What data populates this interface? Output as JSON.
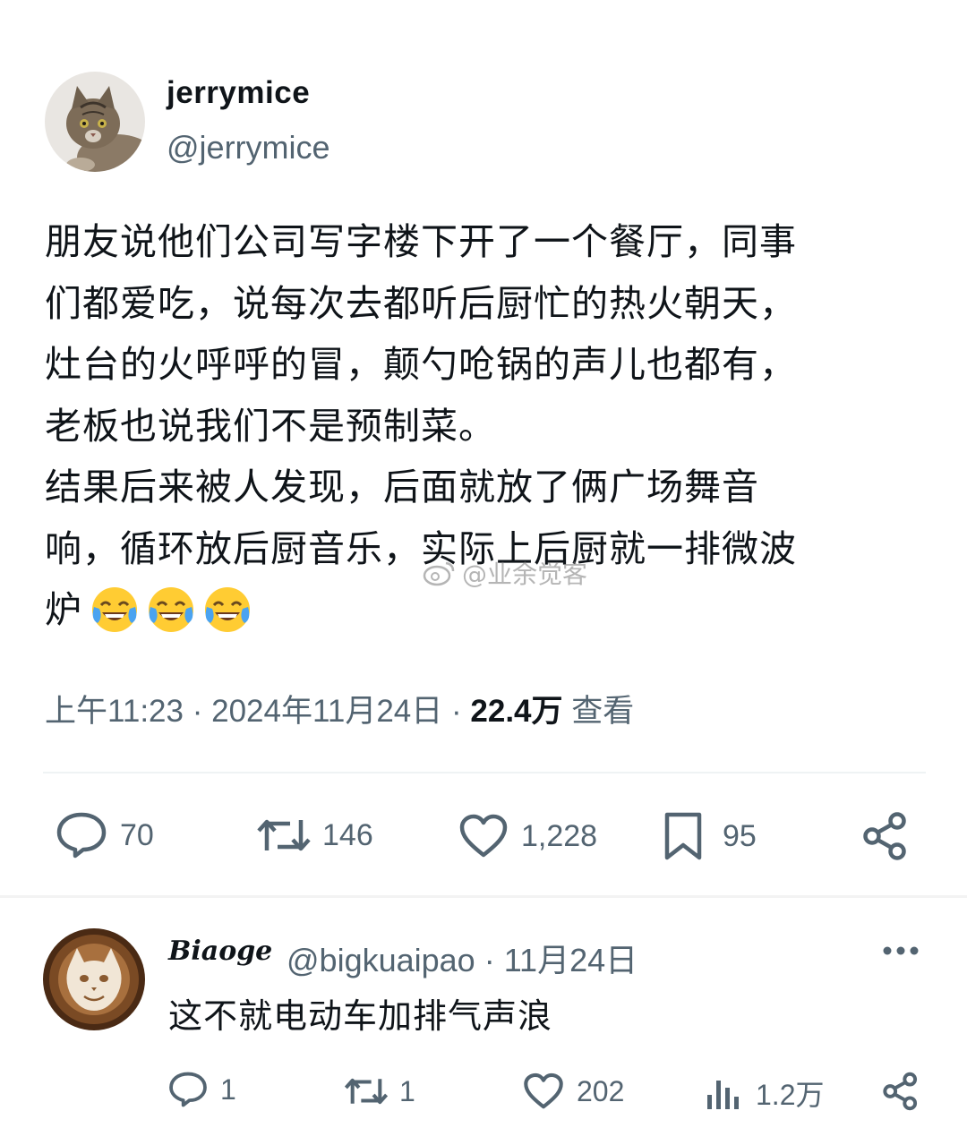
{
  "post": {
    "author_name": "jerrymice",
    "author_handle": "@jerrymice",
    "text": "朋友说他们公司写字楼下开了一个餐厅，同事\n们都爱吃，说每次去都听后厨忙的热火朝天，\n灶台的火呼呼的冒，颠勺呛锅的声儿也都有，\n老板也说我们不是预制菜。\n结果后来被人发现，后面就放了俩广场舞音\n响，循环放后厨音乐，实际上后厨就一排微波\n炉",
    "emojis": [
      "face-with-tears-of-joy",
      "face-with-tears-of-joy",
      "face-with-tears-of-joy"
    ],
    "time": "上午11:23",
    "date": "2024年11月24日",
    "separator": "·",
    "views": "22.4万",
    "views_label": "查看",
    "replies": "70",
    "retweets": "146",
    "likes": "1,228",
    "bookmarks": "95"
  },
  "watermark": "@业余觉客",
  "reply": {
    "author_name": "Biaoge",
    "author_handle": "@bigkuaipao",
    "date": "· 11月24日",
    "text": "这不就电动车加排气声浪",
    "replies": "1",
    "retweets": "1",
    "likes": "202",
    "views": "1.2万"
  },
  "colors": {
    "text": "#0f1419",
    "secondary": "#536471",
    "divider": "#eff3f4",
    "page_bg": "#f3f3f3"
  }
}
